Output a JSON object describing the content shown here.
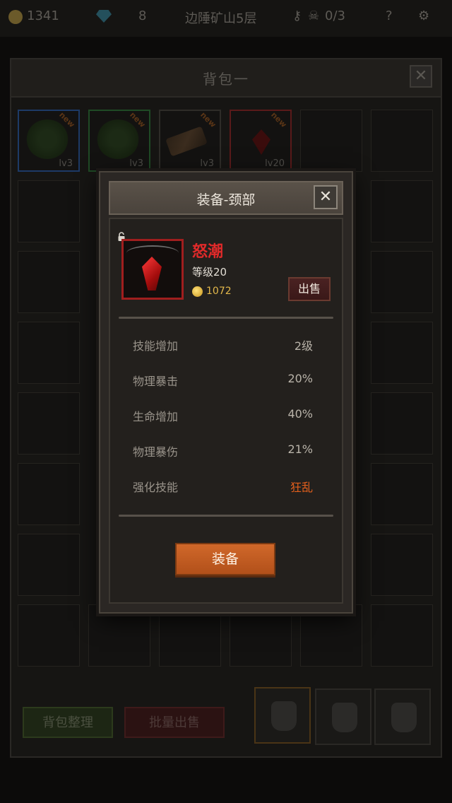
{
  "topbar": {
    "gold": "1341",
    "gems": "8",
    "location": "边陲矿山5层",
    "keys": "0/3"
  },
  "backpack": {
    "title": "背包一",
    "items": [
      {
        "level": "lv3",
        "tag": "new",
        "quality": "blue"
      },
      {
        "level": "lv3",
        "tag": "new",
        "quality": "green"
      },
      {
        "level": "lv3",
        "tag": "new",
        "quality": "gray"
      },
      {
        "level": "lv20",
        "tag": "new",
        "quality": "red"
      }
    ],
    "sort_label": "背包整理",
    "bulk_sell_label": "批量出售"
  },
  "dialog": {
    "title": "装备-颈部",
    "item_name": "怒潮",
    "item_level": "等级20",
    "item_price": "1072",
    "sell_label": "出售",
    "stats": [
      {
        "name": "技能增加",
        "value": "2级"
      },
      {
        "name": "物理暴击",
        "value": "20%"
      },
      {
        "name": "生命增加",
        "value": "40%"
      },
      {
        "name": "物理暴伤",
        "value": "21%"
      },
      {
        "name": "强化技能",
        "value": "狂乱"
      }
    ],
    "equip_label": "装备"
  },
  "colors": {
    "item_name": "#e12a2a",
    "gold_text": "#e3b84b",
    "special_stat": "#e35f1c",
    "equip_button": "#c45e23"
  }
}
